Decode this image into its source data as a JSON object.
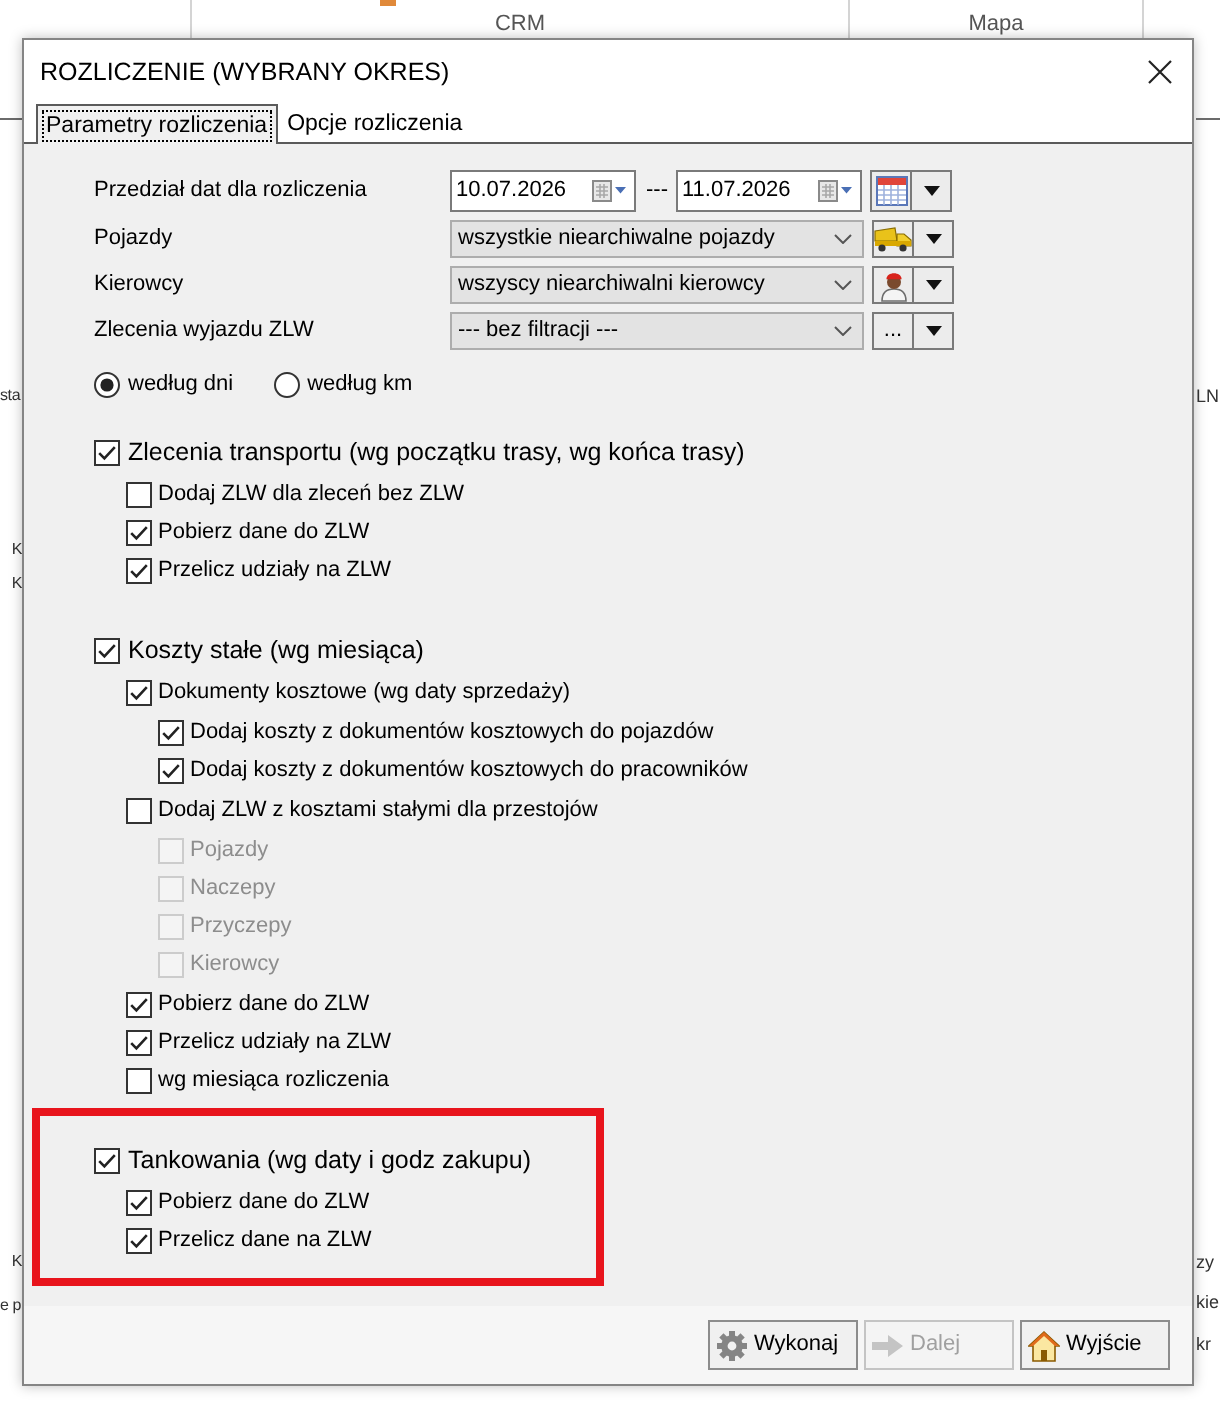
{
  "background": {
    "tabs": [
      "CRM",
      "Mapa"
    ],
    "left_edge_texts": [
      "sta",
      "K",
      "K",
      "K",
      "e p"
    ],
    "right_edge_texts": [
      "LN",
      "zy",
      "kie",
      "kr"
    ]
  },
  "dialog": {
    "title": "ROZLICZENIE (WYBRANY OKRES)",
    "tabs": [
      {
        "label": "Parametry rozliczenia",
        "selected": true
      },
      {
        "label": "Opcje rozliczenia",
        "selected": false
      }
    ],
    "date_range": {
      "label": "Przedział dat dla rozliczenia",
      "from": "10.07.2026",
      "separator": "---",
      "to": "11.07.2026"
    },
    "filters": [
      {
        "label": "Pojazdy",
        "value": "wszystkie niearchiwalne pojazdy",
        "kind": "vehicles"
      },
      {
        "label": "Kierowcy",
        "value": "wszyscy niearchiwalni kierowcy",
        "kind": "drivers"
      },
      {
        "label": "Zlecenia wyjazdu ZLW",
        "value": "--- bez filtracji ---",
        "kind": "text",
        "button_label": "..."
      }
    ],
    "radios": [
      {
        "label": "według dni",
        "selected": true
      },
      {
        "label": "według km",
        "selected": false
      }
    ],
    "sections": [
      {
        "label": "Zlecenia transportu (wg początku trasy, wg końca trasy)",
        "checked": true,
        "highlighted": false,
        "children": [
          {
            "label": "Dodaj ZLW dla zleceń bez ZLW",
            "checked": false
          },
          {
            "label": "Pobierz dane do ZLW",
            "checked": true
          },
          {
            "label": "Przelicz udziały na ZLW",
            "checked": true
          }
        ]
      },
      {
        "label": "Koszty stałe (wg miesiąca)",
        "checked": true,
        "highlighted": false,
        "children": [
          {
            "label": "Dokumenty kosztowe (wg daty sprzedaży)",
            "checked": true,
            "children": [
              {
                "label": "Dodaj koszty z dokumentów kosztowych do pojazdów",
                "checked": true
              },
              {
                "label": "Dodaj koszty z dokumentów kosztowych do pracowników",
                "checked": true
              }
            ]
          },
          {
            "label": "Dodaj ZLW z kosztami stałymi dla przestojów",
            "checked": false,
            "children": [
              {
                "label": "Pojazdy",
                "checked": false,
                "disabled": true
              },
              {
                "label": "Naczepy",
                "checked": false,
                "disabled": true
              },
              {
                "label": "Przyczepy",
                "checked": false,
                "disabled": true
              },
              {
                "label": "Kierowcy",
                "checked": false,
                "disabled": true
              }
            ]
          },
          {
            "label": "Pobierz dane do ZLW",
            "checked": true
          },
          {
            "label": "Przelicz udziały na ZLW",
            "checked": true
          },
          {
            "label": "wg miesiąca rozliczenia",
            "checked": false
          }
        ]
      },
      {
        "label": "Tankowania (wg daty i godz zakupu)",
        "checked": true,
        "highlighted": true,
        "children": [
          {
            "label": "Pobierz dane do ZLW",
            "checked": true
          },
          {
            "label": "Przelicz dane na ZLW",
            "checked": true
          }
        ]
      }
    ],
    "buttons": [
      {
        "label": "Wykonaj",
        "kind": "run",
        "disabled": false
      },
      {
        "label": "Dalej",
        "kind": "next",
        "disabled": true
      },
      {
        "label": "Wyjście",
        "kind": "exit",
        "disabled": false
      }
    ]
  }
}
